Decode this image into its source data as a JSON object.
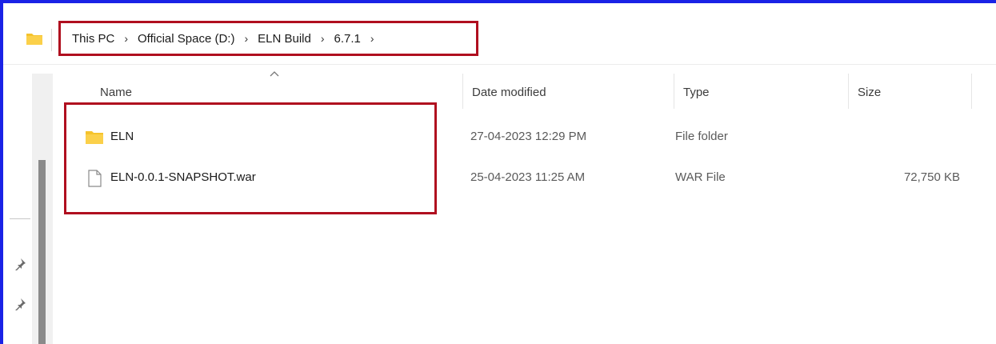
{
  "address": {
    "folder_icon": "folder-icon",
    "breadcrumbs": [
      "This PC",
      "Official Space (D:)",
      "ELN Build",
      "6.7.1"
    ],
    "separator": "›"
  },
  "columns": {
    "name": "Name",
    "date_modified": "Date modified",
    "type": "Type",
    "size": "Size",
    "sort_indicator": "^"
  },
  "files": [
    {
      "icon": "folder-icon",
      "name": "ELN",
      "date_modified": "27-04-2023 12:29 PM",
      "type": "File folder",
      "size": ""
    },
    {
      "icon": "file-icon",
      "name": "ELN-0.0.1-SNAPSHOT.war",
      "date_modified": "25-04-2023 11:25 AM",
      "type": "WAR File",
      "size": "72,750 KB"
    }
  ],
  "colors": {
    "frame": "#1a22e6",
    "highlight": "#b00f1f",
    "folder": "#f5c32c"
  }
}
